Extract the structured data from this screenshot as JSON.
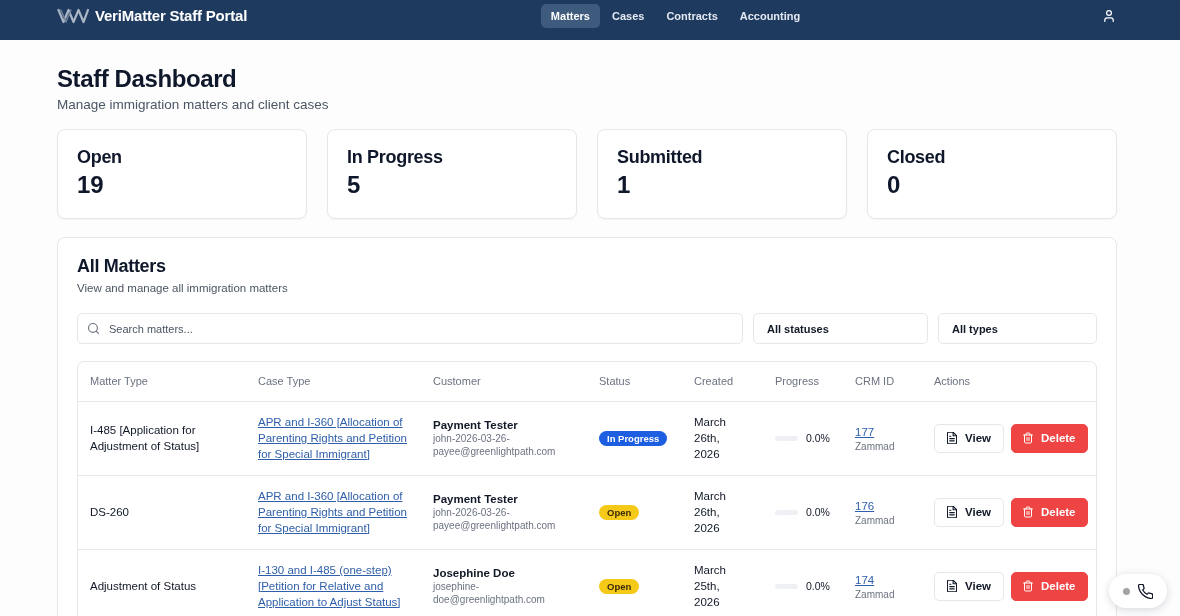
{
  "header": {
    "brand": "VeriMatter Staff Portal",
    "nav": [
      {
        "label": "Matters",
        "selected": true
      },
      {
        "label": "Cases",
        "selected": false
      },
      {
        "label": "Contracts",
        "selected": false
      },
      {
        "label": "Accounting",
        "selected": false
      }
    ]
  },
  "page": {
    "title": "Staff Dashboard",
    "subtitle": "Manage immigration matters and client cases"
  },
  "stats": [
    {
      "label": "Open",
      "value": "19"
    },
    {
      "label": "In Progress",
      "value": "5"
    },
    {
      "label": "Submitted",
      "value": "1"
    },
    {
      "label": "Closed",
      "value": "0"
    }
  ],
  "matters": {
    "title": "All Matters",
    "subtitle": "View and manage all immigration matters",
    "search": {
      "placeholder": "Search matters..."
    },
    "filters": [
      {
        "value": "All statuses"
      },
      {
        "value": "All types"
      }
    ],
    "table": {
      "columns": [
        "Matter Type",
        "Case Type",
        "Customer",
        "Status",
        "Created",
        "Progress",
        "CRM ID",
        "Actions"
      ],
      "rows": [
        {
          "matter_type": "I-485 [Application for Adjustment of Status]",
          "case_type": "APR and I-360 [Allocation of Parenting Rights and Petition for Special Immigrant]",
          "customer": {
            "name": "Payment Tester",
            "email": "john-2026-03-26-payee@greenlightpath.com"
          },
          "status": {
            "label": "In Progress",
            "color": "#1d5fe0"
          },
          "created": "March 26th, 2026",
          "progress": {
            "level": 0,
            "reading": "0.0%"
          },
          "crm": {
            "id": "177",
            "source": "Zammad"
          },
          "actions": [
            {
              "label": "View",
              "kind": "view"
            },
            {
              "label": "Delete",
              "kind": "delete"
            }
          ]
        },
        {
          "matter_type": "DS-260",
          "case_type": "APR and I-360 [Allocation of Parenting Rights and Petition for Special Immigrant]",
          "customer": {
            "name": "Payment Tester",
            "email": "john-2026-03-26-payee@greenlightpath.com"
          },
          "status": {
            "label": "Open",
            "color": "#f5c918"
          },
          "created": "March 26th, 2026",
          "progress": {
            "level": 0,
            "reading": "0.0%"
          },
          "crm": {
            "id": "176",
            "source": "Zammad"
          },
          "actions": [
            {
              "label": "View",
              "kind": "view"
            },
            {
              "label": "Delete",
              "kind": "delete"
            }
          ]
        },
        {
          "matter_type": "Adjustment of Status",
          "case_type": "I-130 and I-485 (one-step) [Petition for Relative and Application to Adjust Status]",
          "customer": {
            "name": "Josephine Doe",
            "email": "josephine-doe@greenlightpath.com"
          },
          "status": {
            "label": "Open",
            "color": "#f5c918"
          },
          "created": "March 25th, 2026",
          "progress": {
            "level": 0,
            "reading": "0.0%"
          },
          "crm": {
            "id": "174",
            "source": "Zammad"
          },
          "actions": [
            {
              "label": "View",
              "kind": "view"
            },
            {
              "label": "Delete",
              "kind": "delete"
            }
          ]
        }
      ]
    }
  }
}
